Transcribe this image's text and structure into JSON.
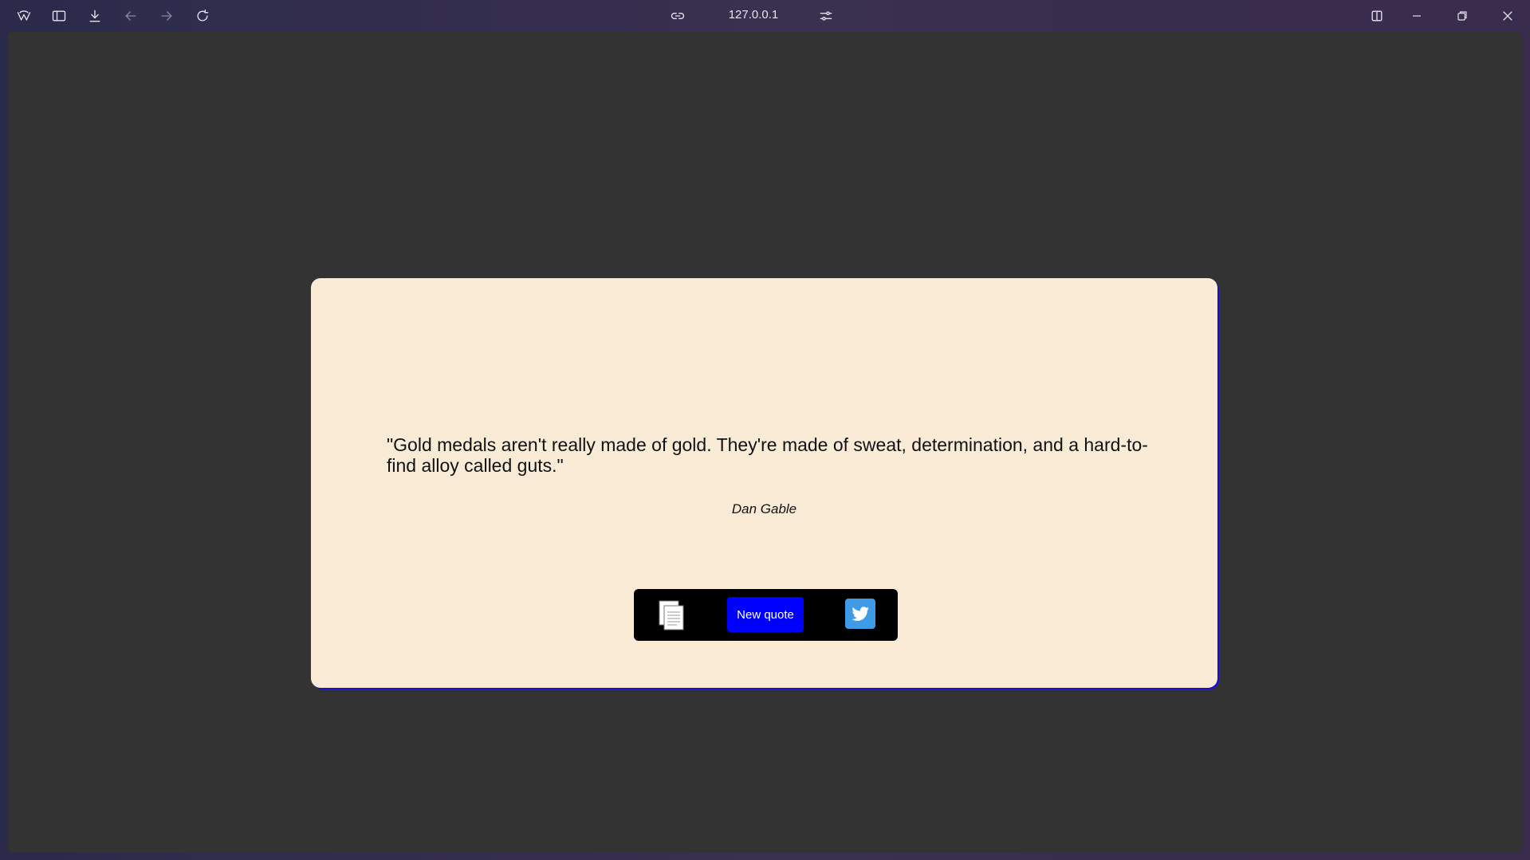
{
  "browser": {
    "url": "127.0.0.1",
    "icons": {
      "app": "browser-logo-icon",
      "sidebar": "sidebar-toggle-icon",
      "download": "download-icon",
      "back": "back-arrow-icon",
      "forward": "forward-arrow-icon",
      "reload": "reload-icon",
      "link": "link-icon",
      "site_settings": "sliders-icon",
      "split_view": "split-view-icon",
      "minimize": "minimize-icon",
      "restore": "restore-icon",
      "close": "close-icon"
    }
  },
  "quote_card": {
    "quote": "\"Gold medals aren't really made of gold. They're made of sweat, determination, and a hard-to-find alloy called guts.\"",
    "author": "Dan Gable",
    "new_quote_label": "New quote",
    "copy_icon": "copy-icon",
    "twitter_icon": "twitter-icon"
  },
  "colors": {
    "card_background": "#faebd7",
    "card_border": "#1a0fd0",
    "button_primary": "#0000ff",
    "twitter": "#3f9ae8",
    "page_background": "#333333"
  }
}
